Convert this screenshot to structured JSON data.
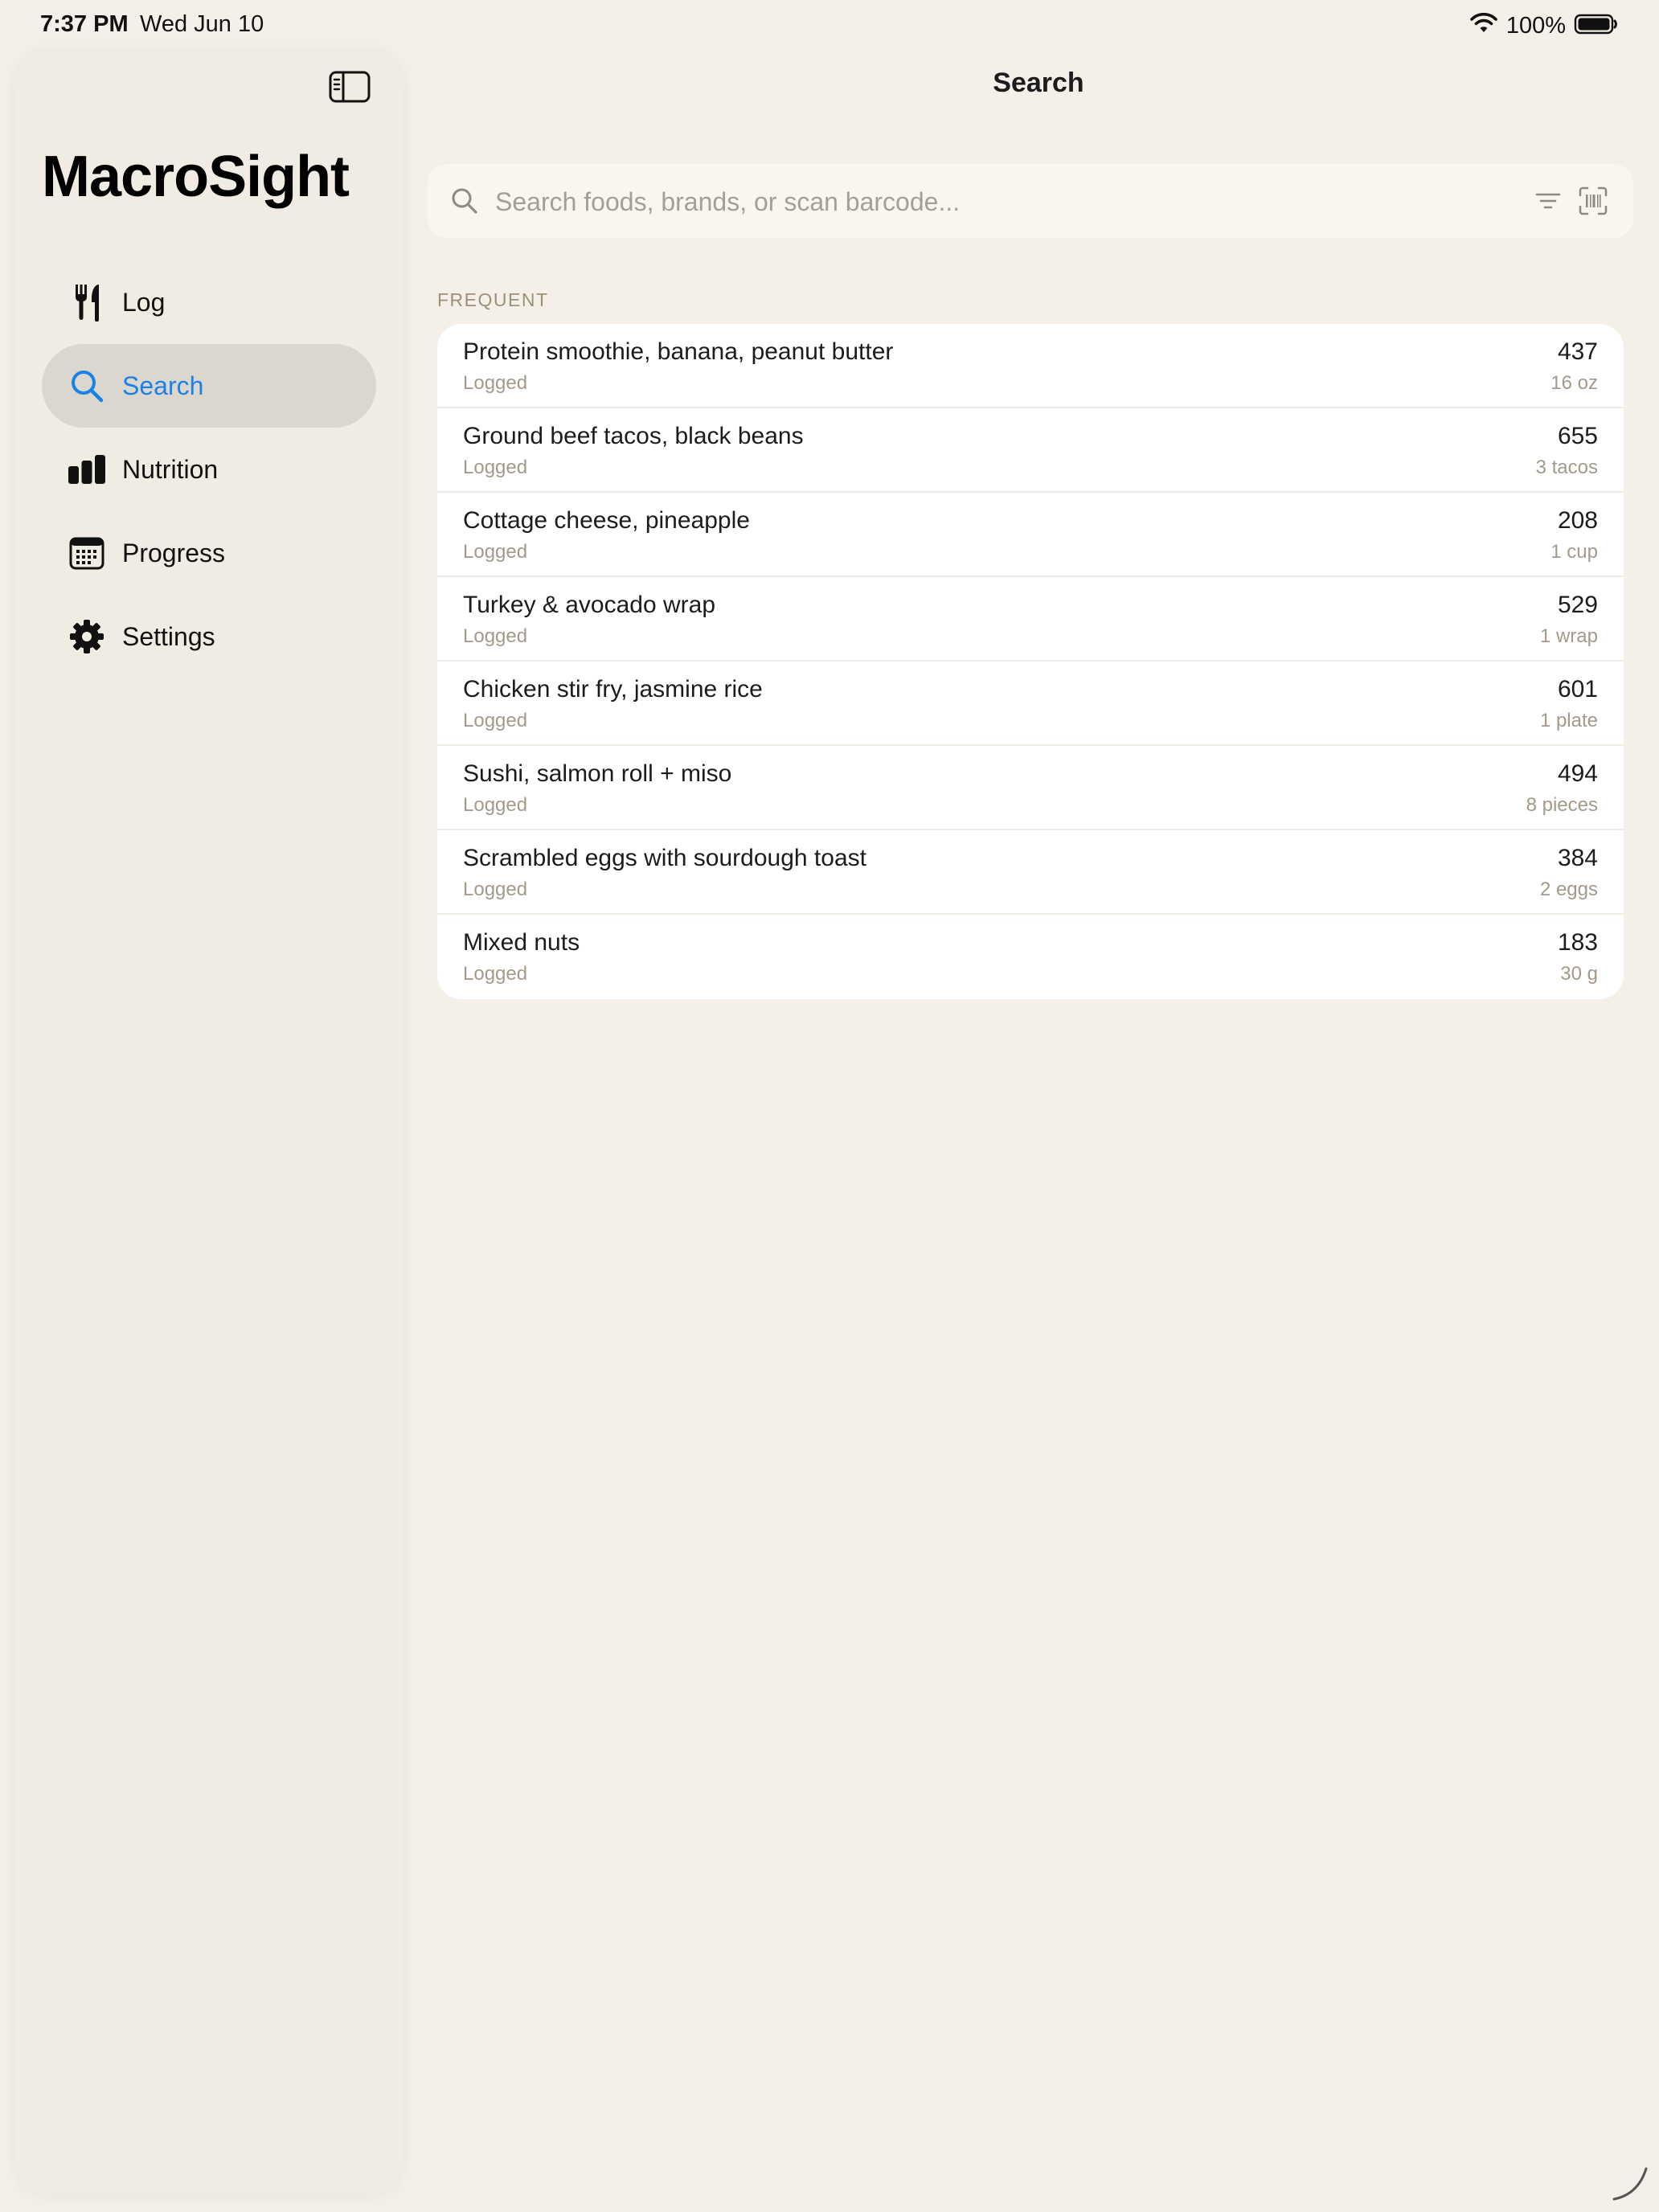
{
  "status_bar": {
    "time": "7:37 PM",
    "date": "Wed Jun 10",
    "battery": "100%"
  },
  "sidebar": {
    "app_title": "MacroSight",
    "items": [
      {
        "label": "Log",
        "icon": "fork-knife-icon",
        "active": false
      },
      {
        "label": "Search",
        "icon": "magnifier-icon",
        "active": true
      },
      {
        "label": "Nutrition",
        "icon": "bar-chart-icon",
        "active": false
      },
      {
        "label": "Progress",
        "icon": "calendar-icon",
        "active": false
      },
      {
        "label": "Settings",
        "icon": "gear-icon",
        "active": false
      }
    ]
  },
  "main": {
    "title": "Search",
    "search": {
      "placeholder": "Search foods, brands, or scan barcode...",
      "value": ""
    },
    "section_label": "FREQUENT",
    "foods": [
      {
        "name": "Protein smoothie, banana, peanut butter",
        "status": "Logged",
        "calories": "437",
        "serving": "16 oz"
      },
      {
        "name": "Ground beef tacos, black beans",
        "status": "Logged",
        "calories": "655",
        "serving": "3 tacos"
      },
      {
        "name": "Cottage cheese, pineapple",
        "status": "Logged",
        "calories": "208",
        "serving": "1 cup"
      },
      {
        "name": "Turkey & avocado wrap",
        "status": "Logged",
        "calories": "529",
        "serving": "1 wrap"
      },
      {
        "name": "Chicken stir fry, jasmine rice",
        "status": "Logged",
        "calories": "601",
        "serving": "1 plate"
      },
      {
        "name": "Sushi, salmon roll + miso",
        "status": "Logged",
        "calories": "494",
        "serving": "8 pieces"
      },
      {
        "name": "Scrambled eggs with sourdough toast",
        "status": "Logged",
        "calories": "384",
        "serving": "2 eggs"
      },
      {
        "name": "Mixed nuts",
        "status": "Logged",
        "calories": "183",
        "serving": "30 g"
      }
    ]
  },
  "colors": {
    "background": "#f4f0e9",
    "sidebar": "#f1ece3",
    "accent": "#1a82e6",
    "active_pill": "#dcd7ce",
    "muted": "#a49a8c"
  }
}
